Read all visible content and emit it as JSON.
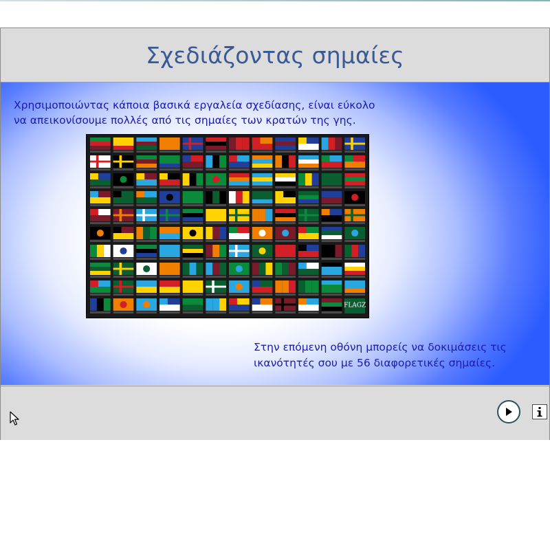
{
  "header": {
    "title": "Σχεδιάζοντας σημαίες"
  },
  "content": {
    "intro_line1": "Χρησιμοποιώντας κάποια βασικά εργαλεία σχεδίασης, είναι εύκολο",
    "intro_line2": "να απεικονίσουμε πολλές από τις σημαίες των κρατών της γης.",
    "next_line1": "Στην επόμενη οθόνη μπορείς να δοκιμάσεις τις",
    "next_line2": "ικανότητές σου  με 56 διαφορετικές σημαίες.",
    "flag_grid": {
      "columns": 12,
      "rows": 10,
      "image_label": "FLAGZ"
    }
  },
  "footer": {
    "play_icon": "play-icon",
    "info_icon": "info-icon",
    "info_label": "i"
  },
  "colors": {
    "title": "#3a5a96",
    "text": "#1a1ab0",
    "panel": "#dcdcdc",
    "accent_blue": "#2c5cff"
  }
}
